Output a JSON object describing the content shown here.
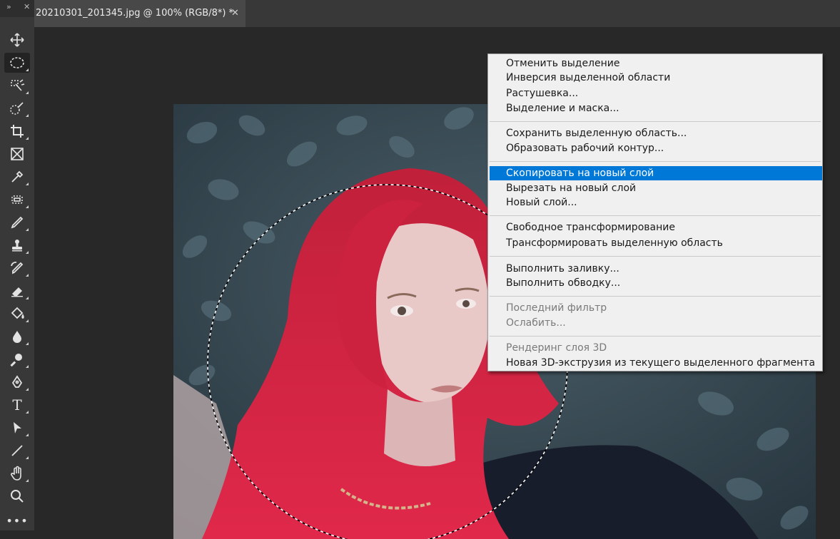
{
  "toolbar": {
    "collapse_glyph": "»",
    "close_glyph": "✕",
    "tools": [
      {
        "name": "move-tool-icon"
      },
      {
        "name": "elliptical-marquee-tool-icon",
        "active": true
      },
      {
        "name": "object-selection-tool-icon"
      },
      {
        "name": "quick-selection-tool-icon"
      },
      {
        "name": "crop-tool-icon"
      },
      {
        "name": "frame-tool-icon"
      },
      {
        "name": "eyedropper-tool-icon"
      },
      {
        "name": "healing-brush-tool-icon"
      },
      {
        "name": "brush-tool-icon"
      },
      {
        "name": "clone-stamp-tool-icon"
      },
      {
        "name": "history-brush-tool-icon"
      },
      {
        "name": "eraser-tool-icon"
      },
      {
        "name": "paint-bucket-tool-icon"
      },
      {
        "name": "blur-tool-icon"
      },
      {
        "name": "dodge-tool-icon"
      },
      {
        "name": "pen-tool-icon"
      },
      {
        "name": "type-tool-icon"
      },
      {
        "name": "path-selection-tool-icon"
      },
      {
        "name": "line-tool-icon"
      },
      {
        "name": "hand-tool-icon"
      },
      {
        "name": "zoom-tool-icon"
      },
      {
        "name": "more-tools-icon"
      }
    ],
    "type_glyph": "T",
    "more_glyph": "•••"
  },
  "document_tab": {
    "title": "20210301_201345.jpg @ 100% (RGB/8*) *",
    "close_glyph": "✕"
  },
  "canvas": {
    "photo_description_icon": "photo-image"
  },
  "context_menu": {
    "items": [
      {
        "label": "Отменить выделение",
        "state": "enabled"
      },
      {
        "label": "Инверсия выделенной области",
        "state": "enabled"
      },
      {
        "label": "Растушевка...",
        "state": "enabled"
      },
      {
        "label": "Выделение и маска...",
        "state": "enabled"
      },
      {
        "label": "Сохранить выделенную область...",
        "state": "enabled"
      },
      {
        "label": "Образовать рабочий контур...",
        "state": "enabled"
      },
      {
        "label": "Скопировать на новый слой",
        "state": "highlighted"
      },
      {
        "label": "Вырезать на новый слой",
        "state": "enabled"
      },
      {
        "label": "Новый слой...",
        "state": "enabled"
      },
      {
        "label": "Свободное трансформирование",
        "state": "enabled"
      },
      {
        "label": "Трансформировать выделенную область",
        "state": "enabled"
      },
      {
        "label": "Выполнить заливку...",
        "state": "enabled"
      },
      {
        "label": "Выполнить обводку...",
        "state": "enabled"
      },
      {
        "label": "Последний фильтр",
        "state": "disabled"
      },
      {
        "label": "Ослабить...",
        "state": "disabled"
      },
      {
        "label": "Рендеринг слоя 3D",
        "state": "disabled"
      },
      {
        "label": "Новая 3D-экструзия из текущего выделенного фрагмента",
        "state": "enabled"
      }
    ],
    "highlight_color": "#0078d7"
  }
}
